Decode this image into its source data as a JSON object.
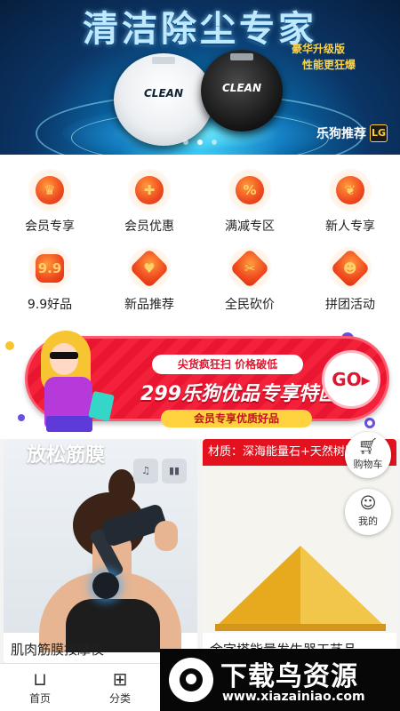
{
  "banner": {
    "title": "清洁除尘专家",
    "subtitle_1": "豪华升级版",
    "subtitle_2": "性能更狂爆",
    "product_label_white": "CLEAN",
    "product_label_black": "CLEAN",
    "brand": "乐狗推荐",
    "brand_logo": "LG",
    "active_slide": 2,
    "slide_count": 3
  },
  "categories": [
    {
      "label": "会员专享",
      "icon": "crown-icon",
      "glyph": "♛",
      "shape": "circle"
    },
    {
      "label": "会员优惠",
      "icon": "gift-icon",
      "glyph": "✚",
      "shape": "circle"
    },
    {
      "label": "满减专区",
      "icon": "discount-tag-icon",
      "glyph": "%",
      "shape": "circle"
    },
    {
      "label": "新人专享",
      "icon": "leaf-icon",
      "glyph": "❦",
      "shape": "circle"
    },
    {
      "label": "9.9好品",
      "icon": "price-99-icon",
      "glyph": "9.9",
      "shape": "hex"
    },
    {
      "label": "新品推荐",
      "icon": "heart-icon",
      "glyph": "♥",
      "shape": "diamond"
    },
    {
      "label": "全民砍价",
      "icon": "bargain-tag-icon",
      "glyph": "✂",
      "shape": "diamond"
    },
    {
      "label": "拼团活动",
      "icon": "group-people-icon",
      "glyph": "☻",
      "shape": "diamond"
    }
  ],
  "promo": {
    "small_text": "尖货疯狂扫 价格破低",
    "main_text": "299乐狗优品专享特区",
    "tag_text": "会员专享优质好品",
    "go_label": "GO▸"
  },
  "products": [
    {
      "image_title": "放松筋膜",
      "name": "肌肉筋膜按摩仪",
      "mini_1": "♫",
      "mini_2": "▮▮"
    },
    {
      "strip_text": "材质：深海能量石+天然树脂+纯",
      "name": "金字塔能量发生器工艺品"
    }
  ],
  "floating": {
    "cart_label": "购物车",
    "me_label": "我的"
  },
  "tabbar": [
    {
      "label": "首页",
      "icon": "home-bag-icon"
    },
    {
      "label": "分类",
      "icon": "category-grid-icon"
    }
  ],
  "watermark": {
    "text": "下载鸟资源",
    "url": "www.xiazainiao.com"
  },
  "colors": {
    "accent_red": "#e4121f",
    "icon_orange": "#ef4a1f",
    "banner_blue": "#0b3566",
    "promo_yellow": "#ffd23f"
  }
}
